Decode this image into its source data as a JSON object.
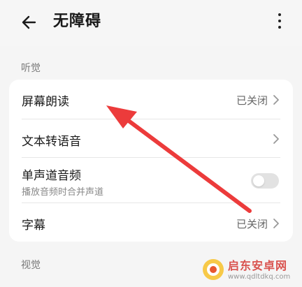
{
  "header": {
    "title": "无障碍",
    "back_icon": "back-arrow-icon",
    "more_icon": "more-vert-icon"
  },
  "sections": {
    "hearing": "听觉",
    "visual": "视觉"
  },
  "hearing_items": [
    {
      "label": "屏幕朗读",
      "status": "已关闭",
      "type": "link"
    },
    {
      "label": "文本转语音",
      "status": "",
      "type": "link"
    },
    {
      "label": "单声道音频",
      "subtitle": "播放音频时合并声道",
      "type": "toggle",
      "on": false
    },
    {
      "label": "字幕",
      "status": "已关闭",
      "type": "link"
    }
  ],
  "annotation": {
    "arrow_color": "#ec3b3b"
  },
  "watermark": {
    "name": "启东安卓网",
    "url": "www.qdltdkq.com"
  },
  "colors": {
    "background": "#f5f5f5",
    "card": "#ffffff",
    "toggle_off": "#e2e2e2"
  }
}
